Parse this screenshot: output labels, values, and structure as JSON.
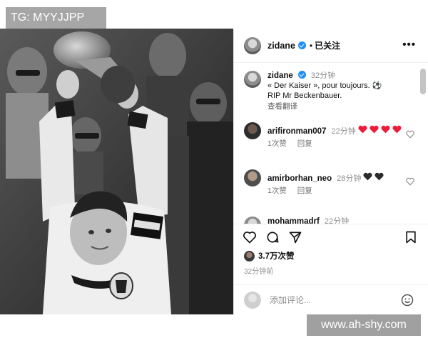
{
  "watermarks": {
    "top_left": "TG: MYYJJPP",
    "bottom_right": "www.ah-shy.com"
  },
  "post": {
    "author": "zidane",
    "follow_state": "已关注",
    "caption_author": "zidane",
    "caption_time": "32分钟",
    "caption_text_line1": "« Der Kaiser », pour toujours.",
    "caption_emoji": "⚽",
    "caption_text_line2": "RIP Mr Beckenbauer.",
    "translate_label": "查看翻译"
  },
  "comments": [
    {
      "user": "arifironman007",
      "time": "22分钟",
      "hearts": 4,
      "likes_label": "1次赞",
      "reply_label": "回复"
    },
    {
      "user": "amirborhan_neo",
      "time": "28分钟",
      "hearts": 2,
      "heart_color": "black",
      "likes_label": "1次赞",
      "reply_label": "回复"
    },
    {
      "user": "mohammadrf",
      "time": "22分钟"
    }
  ],
  "stats": {
    "likes": "3.7万次赞",
    "posted": "32分钟前"
  },
  "add_comment": {
    "placeholder": "添加评论..."
  },
  "icons": [
    "verified-badge-icon",
    "more-icon",
    "heart-icon",
    "comment-icon",
    "share-icon",
    "bookmark-icon",
    "emoji-icon"
  ],
  "colors": {
    "verified": "#1f8ff5",
    "heart_red": "#ed1c3b",
    "muted": "#8e8e8e"
  }
}
